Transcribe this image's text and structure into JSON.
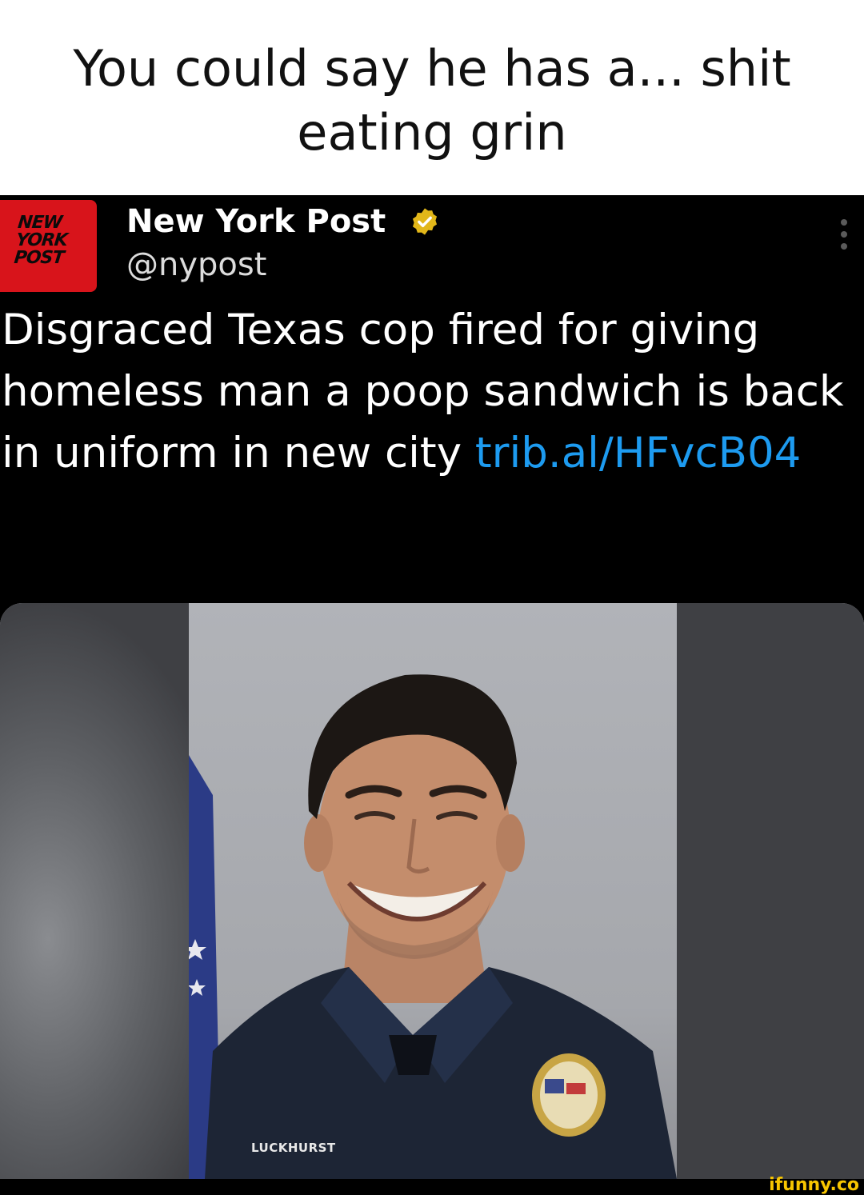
{
  "caption": {
    "line1": "You could say he has a... shit",
    "line2": "eating grin"
  },
  "tweet": {
    "avatar_alt": "NEW YORK POST",
    "avatar_lines": [
      "NEW",
      "YORK",
      "POST"
    ],
    "display_name": "New York Post",
    "verified": true,
    "handle": "@nypost",
    "text_before_link": "Disgraced Texas cop fired for giving homeless man a poop sandwich is back in uniform in new city ",
    "link_text": "trib.al/HFvcB04",
    "link_color": "#1d9bf0",
    "media": {
      "name_tag": "LUCKHURST"
    }
  },
  "watermark": "ifunny.co",
  "colors": {
    "avatar_red": "#d8141b",
    "verified_gold": "#e2b719",
    "background": "#000000"
  }
}
